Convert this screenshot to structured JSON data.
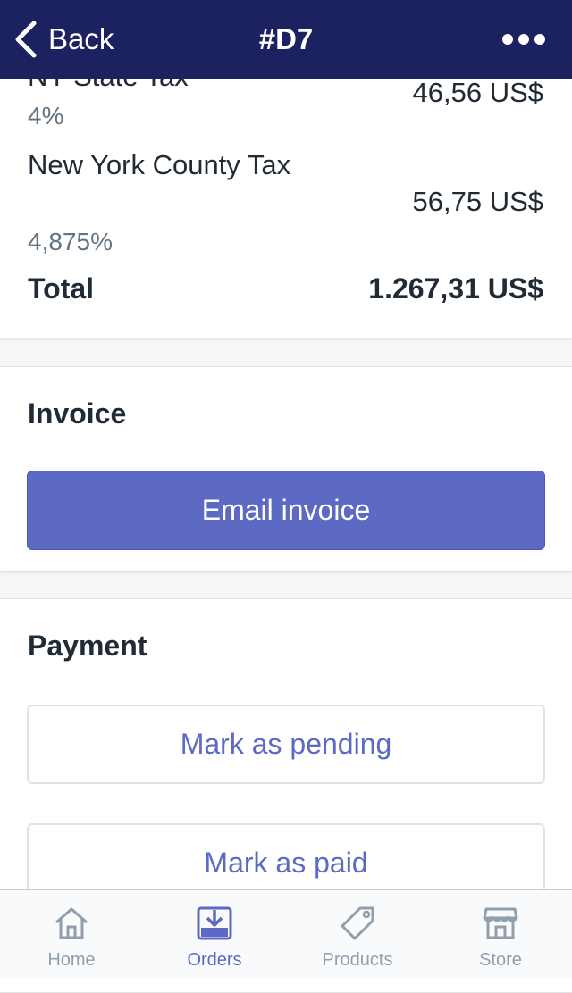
{
  "header": {
    "back_label": "Back",
    "title": "#D7"
  },
  "summary": {
    "taxes": [
      {
        "name": "NY State Tax",
        "rate": "4%",
        "amount": "46,56 US$"
      },
      {
        "name": "New York County Tax",
        "rate": "4,875%",
        "amount": "56,75 US$"
      }
    ],
    "total_label": "Total",
    "total_amount": "1.267,31 US$"
  },
  "invoice": {
    "title": "Invoice",
    "email_button": "Email invoice"
  },
  "payment": {
    "title": "Payment",
    "pending_button": "Mark as pending",
    "paid_button": "Mark as paid"
  },
  "tabs": [
    {
      "label": "Home",
      "icon": "home-icon",
      "active": false
    },
    {
      "label": "Orders",
      "icon": "orders-icon",
      "active": true
    },
    {
      "label": "Products",
      "icon": "tag-icon",
      "active": false
    },
    {
      "label": "Store",
      "icon": "store-icon",
      "active": false
    }
  ],
  "colors": {
    "nav_bg": "#1c2260",
    "accent": "#5c6ac4",
    "muted": "#919eab"
  }
}
